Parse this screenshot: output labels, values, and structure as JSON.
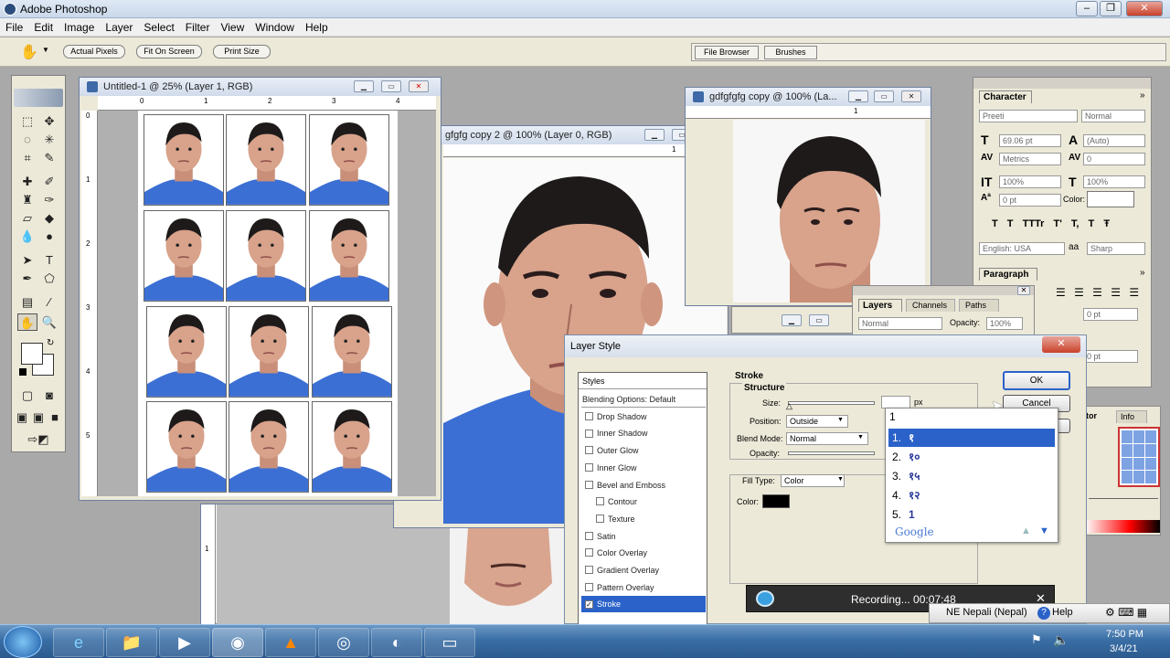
{
  "app": {
    "title": "Adobe Photoshop"
  },
  "menu": [
    "File",
    "Edit",
    "Image",
    "Layer",
    "Select",
    "Filter",
    "View",
    "Window",
    "Help"
  ],
  "options": {
    "actual_pixels": "Actual Pixels",
    "fit_on_screen": "Fit On Screen",
    "print_size": "Print Size"
  },
  "palette_well": {
    "file_browser": "File Browser",
    "brushes": "Brushes"
  },
  "doc1": {
    "title": "Untitled-1 @ 25% (Layer 1, RGB)",
    "ruler_marks": [
      "0",
      "1",
      "2",
      "3",
      "4"
    ],
    "vruler_marks": [
      "0",
      "1",
      "2",
      "3",
      "4",
      "5"
    ]
  },
  "doc2": {
    "title": "gfgfg copy 2 @ 100% (Layer 0, RGB)",
    "ruler_mark": "1"
  },
  "doc3": {
    "title": "gdfgfgfg copy @ 100% (La...",
    "ruler_mark": "1"
  },
  "doc4": {
    "vruler_mark": "1"
  },
  "character": {
    "title": "Character",
    "font": "Preeti",
    "style": "Normal",
    "size": "69.06 pt",
    "leading": "(Auto)",
    "kerning": "Metrics",
    "tracking": "0",
    "vscale": "100%",
    "hscale": "100%",
    "baseline": "0 pt",
    "color_label": "Color:",
    "type_styles": [
      "T",
      "T",
      "TT",
      "Tr",
      "T'",
      "T,",
      "T",
      "Ŧ"
    ],
    "language": "English: USA",
    "aa_label": "a",
    "antialias": "Sharp"
  },
  "paragraph": {
    "title": "Paragraph",
    "indent1": "0 pt",
    "indent2": "0 pt"
  },
  "layers": {
    "tabs": [
      "Layers",
      "Channels",
      "Paths"
    ],
    "mode": "Normal",
    "opacity_label": "Opacity:",
    "opacity": "100%"
  },
  "navigator": {
    "tabs": [
      "ator",
      "Info"
    ]
  },
  "layer_style": {
    "title": "Layer Style",
    "styles_header": "Styles",
    "items": [
      {
        "label": "Blending Options: Default",
        "checkbox": false,
        "checked": false,
        "selected": false,
        "indent": false
      },
      {
        "label": "Drop Shadow",
        "checkbox": true,
        "checked": false,
        "selected": false,
        "indent": false
      },
      {
        "label": "Inner Shadow",
        "checkbox": true,
        "checked": false,
        "selected": false,
        "indent": false
      },
      {
        "label": "Outer Glow",
        "checkbox": true,
        "checked": false,
        "selected": false,
        "indent": false
      },
      {
        "label": "Inner Glow",
        "checkbox": true,
        "checked": false,
        "selected": false,
        "indent": false
      },
      {
        "label": "Bevel and Emboss",
        "checkbox": true,
        "checked": false,
        "selected": false,
        "indent": false
      },
      {
        "label": "Contour",
        "checkbox": true,
        "checked": false,
        "selected": false,
        "indent": true
      },
      {
        "label": "Texture",
        "checkbox": true,
        "checked": false,
        "selected": false,
        "indent": true
      },
      {
        "label": "Satin",
        "checkbox": true,
        "checked": false,
        "selected": false,
        "indent": false
      },
      {
        "label": "Color Overlay",
        "checkbox": true,
        "checked": false,
        "selected": false,
        "indent": false
      },
      {
        "label": "Gradient Overlay",
        "checkbox": true,
        "checked": false,
        "selected": false,
        "indent": false
      },
      {
        "label": "Pattern Overlay",
        "checkbox": true,
        "checked": false,
        "selected": false,
        "indent": false
      },
      {
        "label": "Stroke",
        "checkbox": true,
        "checked": true,
        "selected": true,
        "indent": false
      }
    ],
    "stroke_heading": "Stroke",
    "structure_heading": "Structure",
    "size_label": "Size:",
    "size_value": "",
    "size_unit": "px",
    "position_label": "Position:",
    "position_value": "Outside",
    "blend_label": "Blend Mode:",
    "blend_value": "Normal",
    "opacity_label": "Opacity:",
    "fill_label": "Fill Type:",
    "fill_value": "Color",
    "color_label": "Color:",
    "stroke_color": "#000000",
    "ok": "OK",
    "cancel": "Cancel"
  },
  "ime": {
    "input": "1",
    "candidates": [
      {
        "n": "1.",
        "text": "१"
      },
      {
        "n": "2.",
        "text": "१०"
      },
      {
        "n": "3.",
        "text": "१५"
      },
      {
        "n": "4.",
        "text": "१२"
      },
      {
        "n": "5.",
        "text": "1"
      }
    ],
    "brand": "Google"
  },
  "recording": {
    "status": "Recording... 00:07:48",
    "close": "✕"
  },
  "langbar": {
    "language": "NE Nepali (Nepal)",
    "help": "Help"
  },
  "clock": {
    "time": "7:50 PM",
    "date": "3/4/21"
  },
  "colors": {
    "accent": "#316ac5",
    "shirt": "#3b6fd4",
    "selection": "#2a62c9"
  }
}
